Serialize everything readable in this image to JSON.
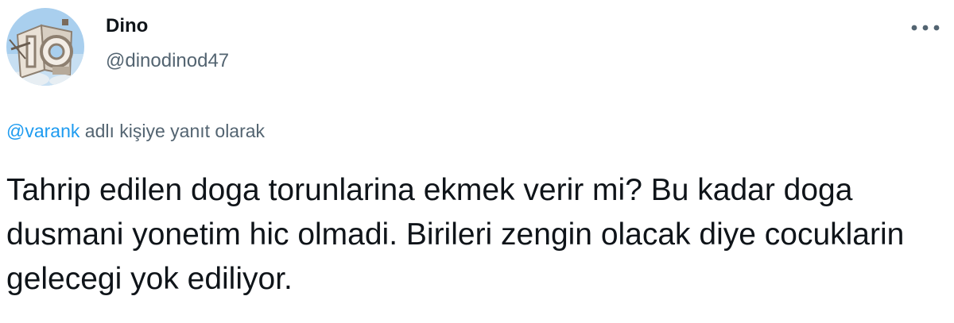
{
  "author": {
    "display_name": "Dino",
    "handle": "@dinodinod47"
  },
  "avatar": {
    "icon": "profile-picture",
    "sky_color": "#9cc8ea"
  },
  "menu": {
    "icon": "more-options-icon"
  },
  "reply_context": {
    "handle": "@varank",
    "suffix": " adlı kişiye yanıt olarak"
  },
  "tweet": {
    "text": "Tahrip edilen doga torunlarina ekmek verir mi? Bu kadar doga dusmani yonetim hic olmadi. Birileri zengin olacak diye cocuklarin gelecegi yok ediliyor."
  },
  "colors": {
    "link": "#1d9bf0",
    "secondary_text": "#536471",
    "primary_text": "#0f1419"
  }
}
